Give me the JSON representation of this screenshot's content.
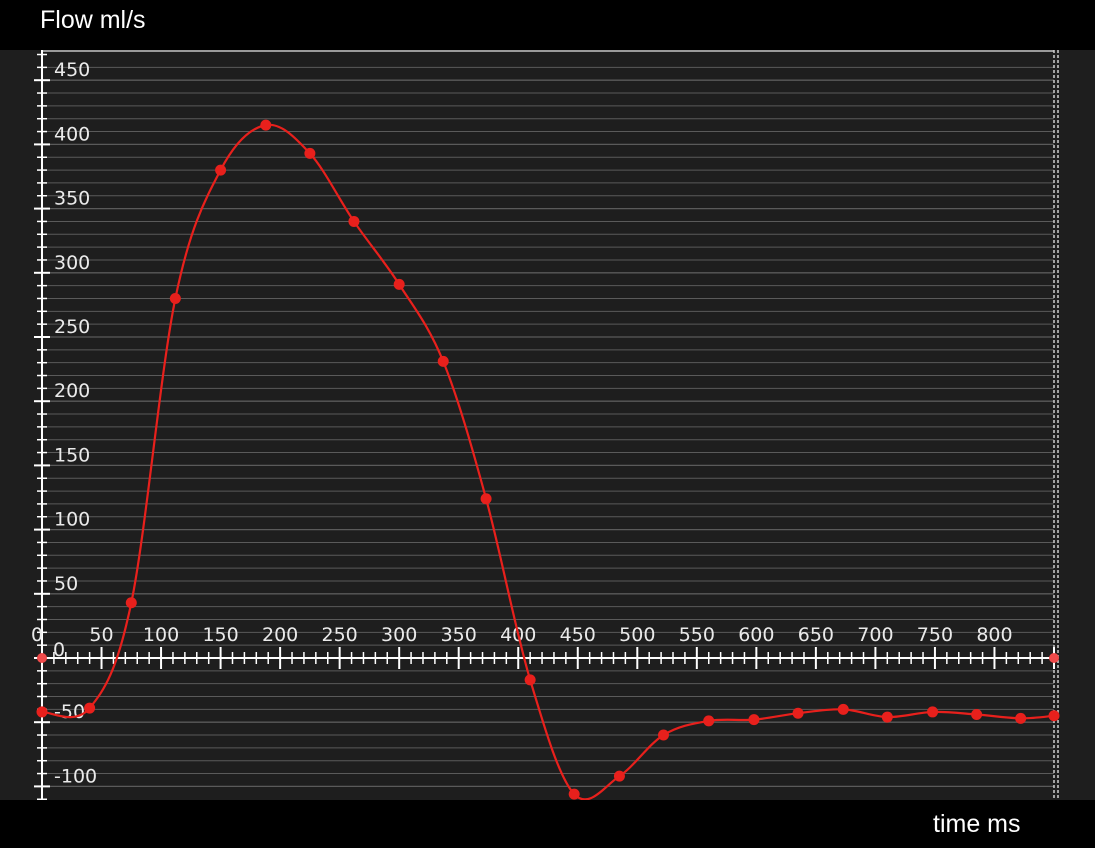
{
  "labels": {
    "y_unit": "Flow ml/s",
    "x_unit": "time ms",
    "zero_label": "0"
  },
  "colors": {
    "background": "#1e1e1e",
    "grid": "#5a5a5a",
    "axis": "#ffffff",
    "series": "#e8201c"
  },
  "chart_data": {
    "type": "line",
    "xlabel": "time ms",
    "ylabel": "Flow ml/s",
    "xlim": [
      0,
      850
    ],
    "ylim": [
      -110,
      470
    ],
    "xticks": [
      50,
      100,
      150,
      200,
      250,
      300,
      350,
      400,
      450,
      500,
      550,
      600,
      650,
      700,
      750,
      800
    ],
    "xtick_origin_label": "0",
    "yticks": [
      -100,
      -50,
      50,
      100,
      150,
      200,
      250,
      300,
      350,
      400,
      450
    ],
    "ytick_labels": [
      "-100",
      "-50",
      "50",
      "100",
      "150",
      "200",
      "250",
      "300",
      "350",
      "400",
      "450"
    ],
    "grid": true,
    "series": [
      {
        "x": [
          0,
          40,
          75,
          112,
          150,
          188,
          225,
          262,
          300,
          337,
          373,
          410,
          447,
          485,
          522,
          560,
          598,
          635,
          673,
          710,
          748,
          785,
          822,
          850
        ],
        "y": [
          -42,
          -39,
          43,
          280,
          380,
          415,
          393,
          340,
          291,
          231,
          124,
          -17,
          -106,
          -92,
          -60,
          -49,
          -48,
          -43,
          -40,
          -46,
          -42,
          -44,
          -47,
          -45
        ]
      }
    ],
    "endpoint_markers": {
      "x": [
        0,
        850
      ],
      "y": [
        0,
        0
      ]
    }
  }
}
